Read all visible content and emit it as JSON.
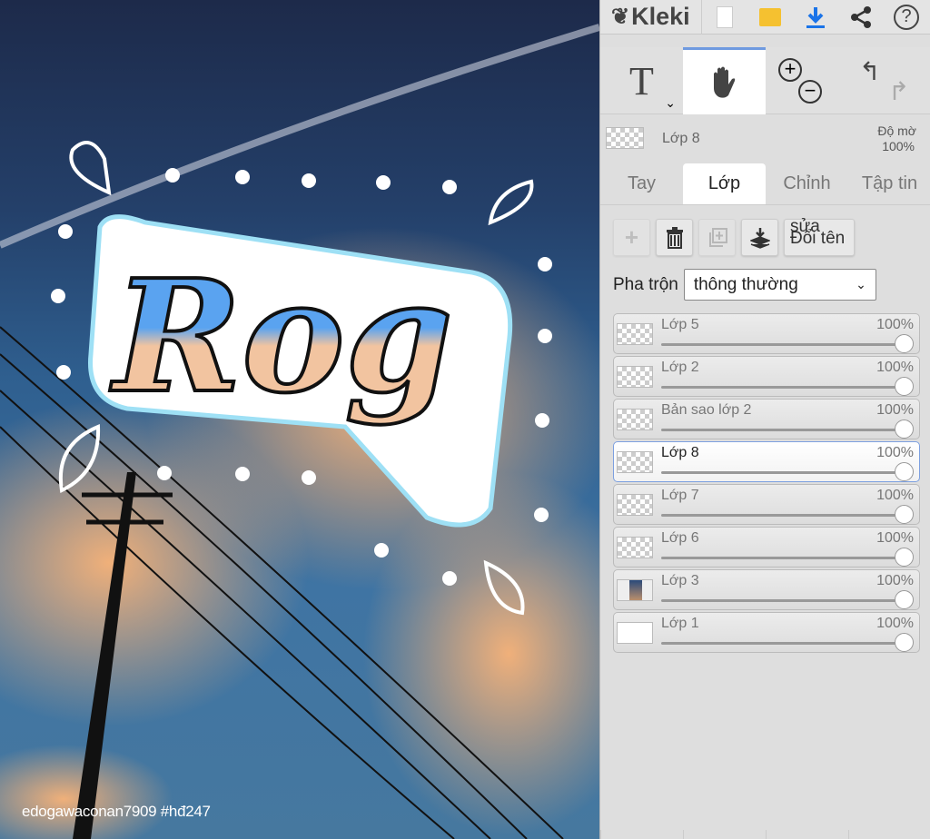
{
  "canvas": {
    "credit": "edogawaconan7909   #hđ247",
    "artwork_text": "Rog"
  },
  "topbar": {
    "logo": "Kleki",
    "icons": [
      "new-file-icon",
      "open-folder-icon",
      "download-icon",
      "share-icon",
      "help-icon"
    ]
  },
  "toolbar": {
    "text_tool": "T",
    "active_tool": "hand"
  },
  "layer_info": {
    "name": "Lớp 8",
    "opacity_label": "Độ mờ",
    "opacity_value": "100%"
  },
  "tabs": [
    {
      "label": "Tay"
    },
    {
      "label": "Lớp",
      "active": true
    },
    {
      "label": "Chỉnh"
    },
    {
      "label": "Tập tin"
    }
  ],
  "layer_buttons": {
    "rename_top": "sửa",
    "rename": "Đổi tên"
  },
  "blend": {
    "label": "Pha trộn",
    "value": "thông thường"
  },
  "layers": [
    {
      "name": "Lớp 5",
      "opacity": "100%"
    },
    {
      "name": "Lớp 2",
      "opacity": "100%"
    },
    {
      "name": "Bản sao lớp 2",
      "opacity": "100%"
    },
    {
      "name": "Lớp 8",
      "opacity": "100%",
      "selected": true
    },
    {
      "name": "Lớp 7",
      "opacity": "100%"
    },
    {
      "name": "Lớp 6",
      "opacity": "100%"
    },
    {
      "name": "Lớp 3",
      "opacity": "100%"
    },
    {
      "name": "Lớp 1",
      "opacity": "100%"
    }
  ],
  "colors": {
    "accent": "#1a73e8",
    "folder": "#f5c130"
  }
}
